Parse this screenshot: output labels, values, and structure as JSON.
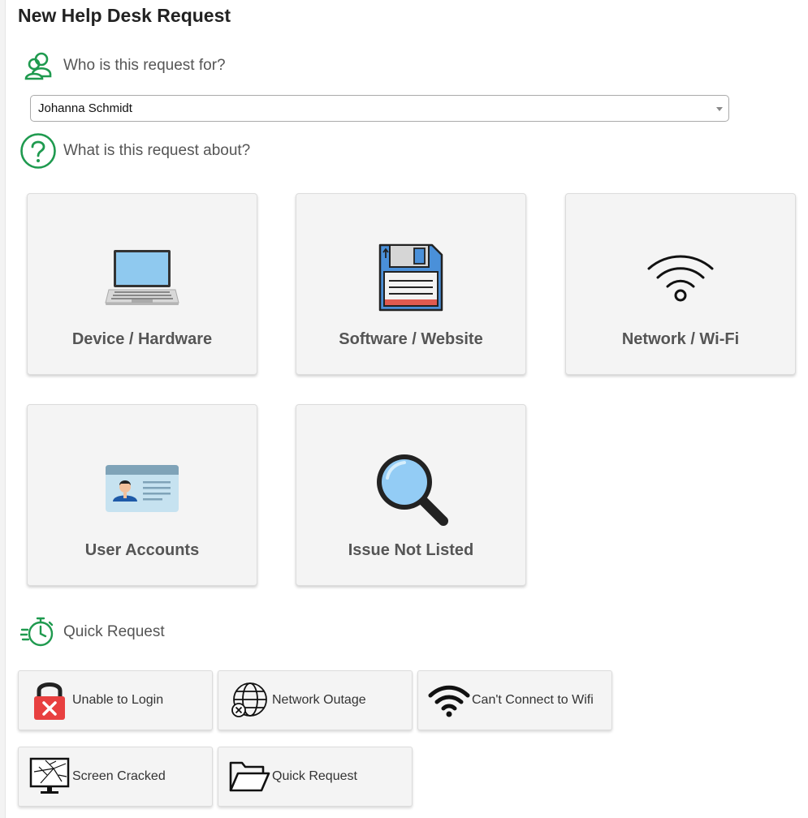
{
  "page": {
    "title": "New Help Desk Request"
  },
  "requester": {
    "question": "Who is this request for?",
    "selected": "Johanna Schmidt"
  },
  "about": {
    "question": "What is this request about?",
    "categories": [
      {
        "label": "Device / Hardware",
        "icon": "laptop-icon"
      },
      {
        "label": "Software / Website",
        "icon": "floppy-disk-icon"
      },
      {
        "label": "Network / Wi-Fi",
        "icon": "wifi-icon"
      },
      {
        "label": "User Accounts",
        "icon": "id-card-icon"
      },
      {
        "label": "Issue Not Listed",
        "icon": "magnifier-icon"
      }
    ]
  },
  "quick": {
    "heading": "Quick Request",
    "items": [
      {
        "label": "Unable to Login",
        "icon": "padlock-error-icon"
      },
      {
        "label": "Network Outage",
        "icon": "globe-error-icon"
      },
      {
        "label": "Can't Connect to Wifi",
        "icon": "wifi-icon"
      },
      {
        "label": "Screen Cracked",
        "icon": "cracked-monitor-icon"
      },
      {
        "label": "Quick Request",
        "icon": "folder-icon"
      }
    ]
  },
  "colors": {
    "accent": "#1f9a4f",
    "tile_bg": "#f4f4f4",
    "tile_label": "#555555"
  }
}
